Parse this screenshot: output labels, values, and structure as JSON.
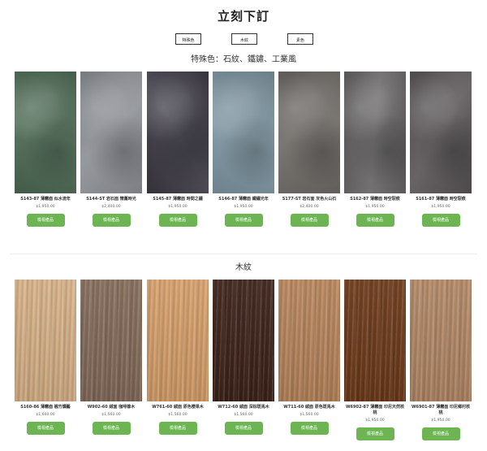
{
  "page": {
    "title": "立刻下訂"
  },
  "tabs": [
    {
      "label": "特殊色"
    },
    {
      "label": "木紋"
    },
    {
      "label": "素色"
    }
  ],
  "sections": {
    "special": {
      "title": "特殊色：石紋、鐵鏽、工業風",
      "items": [
        {
          "name": "S143-87 薄霧面 似水流年",
          "price": "$1,950.00",
          "button": "檢視產品",
          "color": "#4e6a55"
        },
        {
          "name": "S144-ST 岩石面 懷舊時光",
          "price": "$2,400.00",
          "button": "檢視產品",
          "color": "#8d9096"
        },
        {
          "name": "S145-87 薄霧面 時間之鏽",
          "price": "$1,950.00",
          "button": "檢視產品",
          "color": "#3d3a45"
        },
        {
          "name": "S146-87 薄霧面 鐵鏽光年",
          "price": "$1,950.00",
          "button": "檢視產品",
          "color": "#7d94a0"
        },
        {
          "name": "S177-ST 岩石面 灰色火山石",
          "price": "$2,400.00",
          "button": "檢視產品",
          "color": "#6f6b67"
        },
        {
          "name": "S162-87 薄霧面 時空裂痕",
          "price": "$1,950.00",
          "button": "檢視產品",
          "color": "#676566"
        },
        {
          "name": "S161-87 薄霧面 時空裂痕",
          "price": "$1,950.00",
          "button": "檢視產品",
          "color": "#5a5658"
        }
      ]
    },
    "wood": {
      "title": "木紋",
      "items": [
        {
          "name": "S160-86 薄霧面 楓竹爛藝",
          "price": "$1,600.00",
          "button": "檢視產品",
          "color": "#d8b288"
        },
        {
          "name": "W902-60 絨面 咖啡橡木",
          "price": "$1,560.00",
          "button": "檢視產品",
          "color": "#846b5a"
        },
        {
          "name": "W761-60 絨面 原色櫻果木",
          "price": "$1,560.00",
          "button": "檢視產品",
          "color": "#d7a06b"
        },
        {
          "name": "W712-60 絨面 深棕斑馬木",
          "price": "$1,560.00",
          "button": "檢視產品",
          "color": "#3d2219"
        },
        {
          "name": "W711-60 絨面 原色斑馬木",
          "price": "$1,560.00",
          "button": "檢視產品",
          "color": "#b8855b"
        },
        {
          "name": "W6902-87 薄霧面 印尼天然核桃",
          "price": "$1,950.00",
          "button": "檢視產品",
          "color": "#6d3a1a"
        },
        {
          "name": "W6901-87 薄霧面 印尼鄉村核桃",
          "price": "$1,950.00",
          "button": "檢視產品",
          "color": "#b38866"
        }
      ]
    }
  }
}
